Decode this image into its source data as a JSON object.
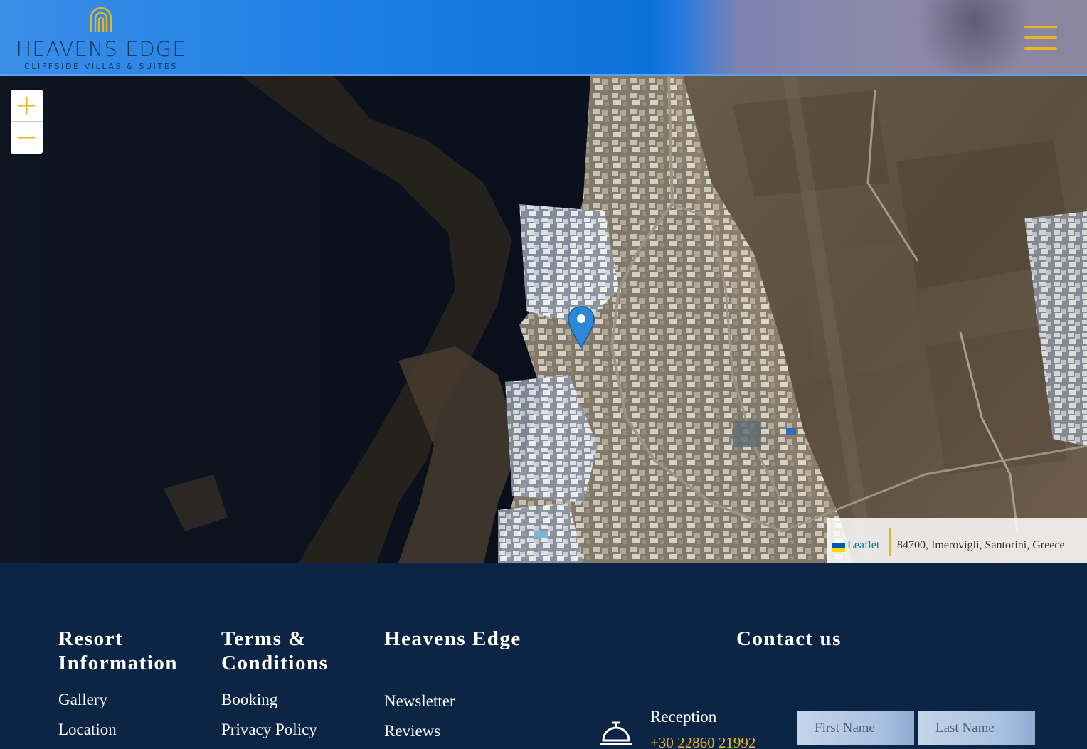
{
  "header": {
    "logo_name": "HEAVENS EDGE",
    "logo_tagline": "CLIFFSIDE VILLAS & SUITES",
    "menu_icon": "hamburger-menu-icon",
    "accent_color": "#e9b423"
  },
  "map": {
    "zoom_in_icon": "plus-icon",
    "zoom_out_icon": "minus-icon",
    "marker_icon": "location-pin-icon",
    "attribution": {
      "leaflet_label": "Leaflet",
      "address": "84700, Imerovigli, Santorini, Greece"
    }
  },
  "footer": {
    "columns": [
      {
        "title": "Resort Information",
        "links": [
          "Gallery",
          "Location"
        ]
      },
      {
        "title": "Terms & Conditions",
        "links": [
          "Booking",
          "Privacy Policy"
        ]
      },
      {
        "title": "Heavens Edge",
        "links": [
          "Newsletter",
          "Reviews"
        ]
      }
    ],
    "contact": {
      "title": "Contact us",
      "icon": "reception-bell-icon",
      "reception_label": "Reception",
      "phone": "+30 22860 21992",
      "first_name_placeholder": "First Name",
      "last_name_placeholder": "Last Name"
    }
  }
}
